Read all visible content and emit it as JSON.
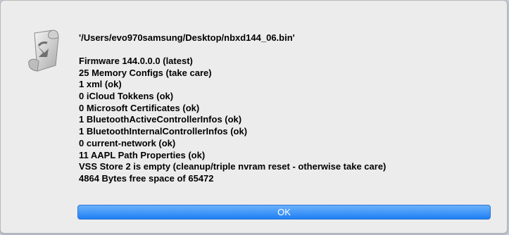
{
  "dialog": {
    "path": "'/Users/evo970samsung/Desktop/nbxd144_06.bin'",
    "lines": [
      "Firmware 144.0.0.0 (latest)",
      "25 Memory Configs (take care)",
      "1 xml (ok)",
      "0 iCloud Tokkens (ok)",
      "0 Microsoft Certificates (ok)",
      "1 BluetoothActiveControllerInfos (ok)",
      "1 BluetoothInternalControllerInfos (ok)",
      "0 current-network (ok)",
      "11 AAPL Path Properties (ok)",
      "VSS Store 2 is empty (cleanup/triple nvram reset - otherwise take care)",
      "4864 Bytes free space of 65472"
    ],
    "ok_label": "OK",
    "icon": "script-scroll-icon"
  }
}
